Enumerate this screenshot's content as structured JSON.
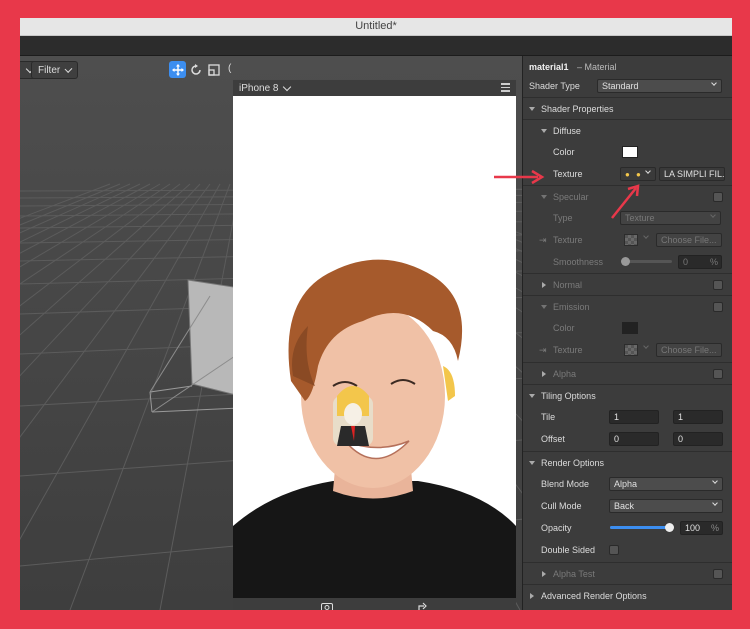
{
  "window": {
    "title": "Untitled*"
  },
  "viewport": {
    "filter_label": "Filter",
    "device_label": "iPhone 8",
    "stray_label": "("
  },
  "inspector": {
    "material_name": "material1",
    "material_type": "– Material",
    "shader_type_label": "Shader Type",
    "shader_type_value": "Standard",
    "shader_properties": "Shader Properties",
    "diffuse": "Diffuse",
    "diffuse_color_label": "Color",
    "diffuse_color": "#ffffff",
    "diffuse_texture_label": "Texture",
    "diffuse_texture_value": "LA SIMPLI FIL...",
    "specular": "Specular",
    "specular_type_label": "Type",
    "specular_type_value": "Texture",
    "specular_texture_label": "Texture",
    "specular_texture_button": "Choose File...",
    "smoothness_label": "Smoothness",
    "smoothness_value": "0",
    "smoothness_unit": "%",
    "normal": "Normal",
    "emission": "Emission",
    "emission_color_label": "Color",
    "emission_color": "#222222",
    "emission_texture_label": "Texture",
    "emission_texture_button": "Choose File...",
    "alpha": "Alpha",
    "tiling_options": "Tiling Options",
    "tile_label": "Tile",
    "tile_x": "1",
    "tile_y": "1",
    "offset_label": "Offset",
    "offset_x": "0",
    "offset_y": "0",
    "render_options": "Render Options",
    "blend_mode_label": "Blend Mode",
    "blend_mode_value": "Alpha",
    "cull_mode_label": "Cull Mode",
    "cull_mode_value": "Back",
    "opacity_label": "Opacity",
    "opacity_value": "100",
    "opacity_unit": "%",
    "opacity_fraction": 1.0,
    "double_sided_label": "Double Sided",
    "alpha_test": "Alpha Test",
    "advanced_render_options": "Advanced Render Options"
  },
  "colors": {
    "annotation_arrow": "#e8384a",
    "accent": "#3c8ef0"
  }
}
